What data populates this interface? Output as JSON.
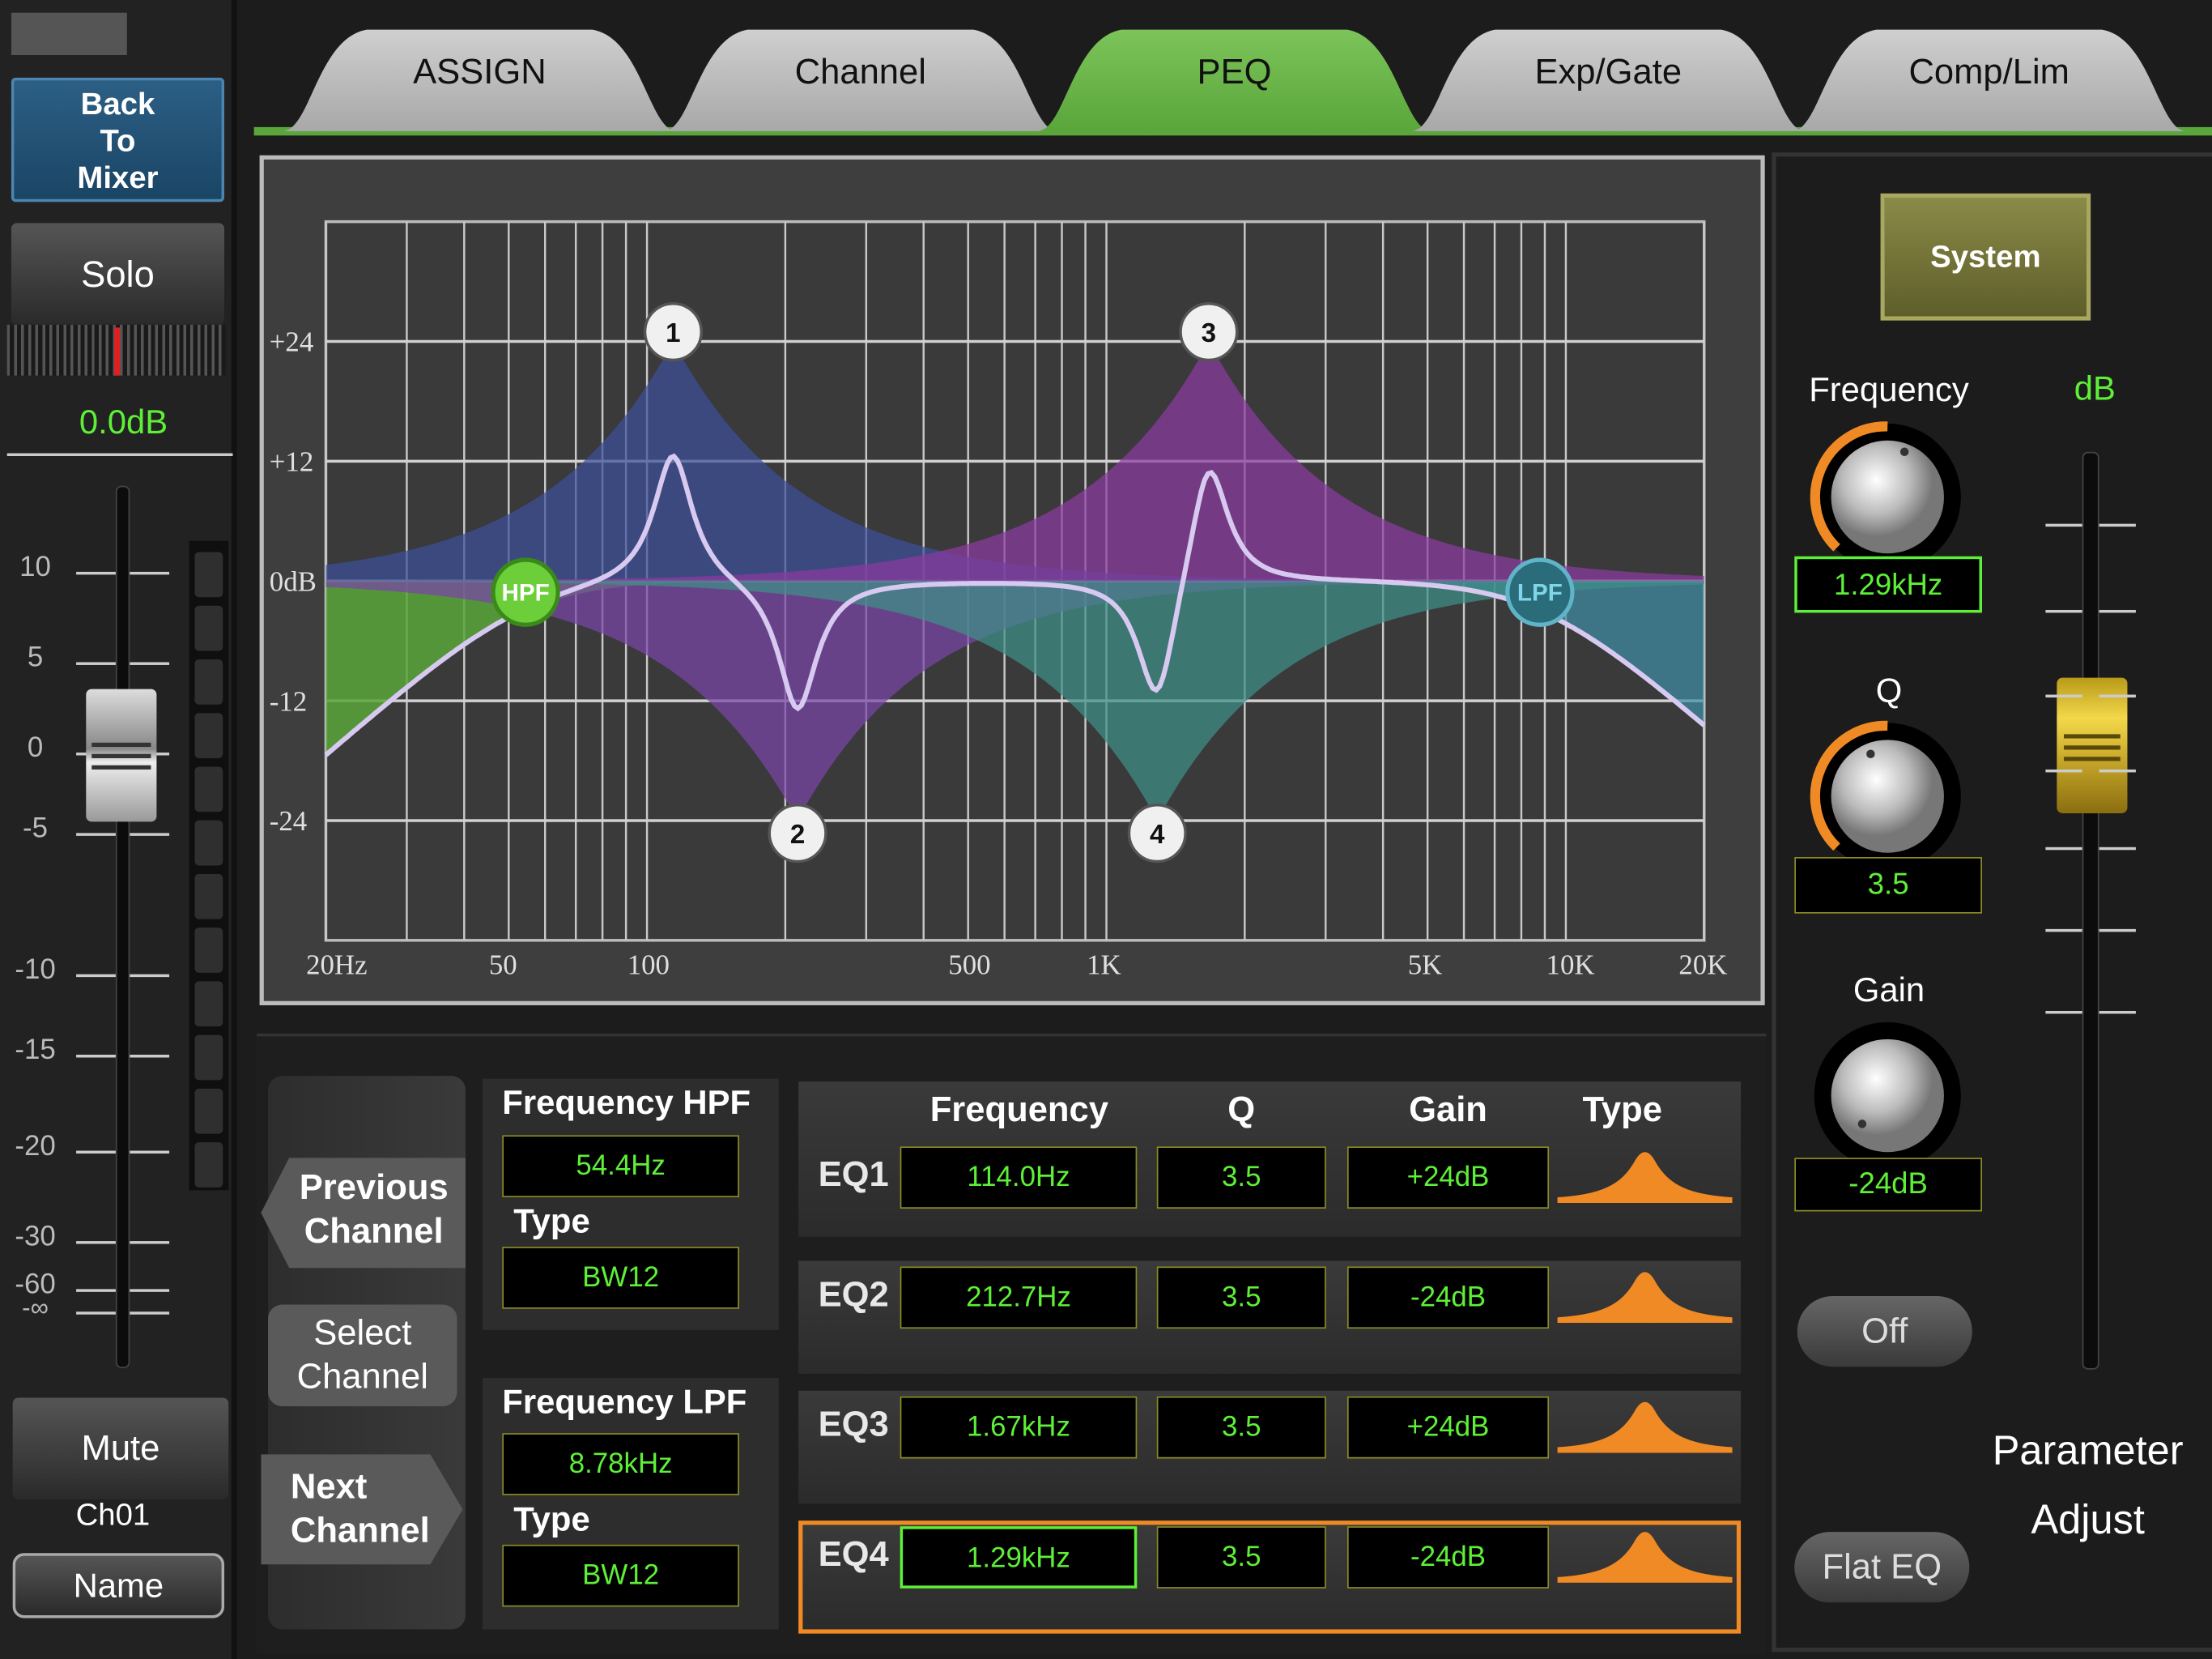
{
  "left_strip": {
    "back_label": "Back To Mixer",
    "solo_label": "Solo",
    "level_readout": "0.0dB",
    "fader_scale": [
      "10",
      "5",
      "0",
      "-5",
      "-10",
      "-15",
      "-20",
      "-30",
      "-60",
      "-∞"
    ],
    "mute_label": "Mute",
    "channel_name": "Ch01",
    "name_button": "Name"
  },
  "tabs": [
    {
      "label": "ASSIGN",
      "active": false
    },
    {
      "label": "Channel",
      "active": false
    },
    {
      "label": "PEQ",
      "active": true
    },
    {
      "label": "Exp/Gate",
      "active": false
    },
    {
      "label": "Comp/Lim",
      "active": false
    }
  ],
  "graph": {
    "y_labels": [
      "+24",
      "+12",
      "0dB",
      "-12",
      "-24"
    ],
    "x_labels": [
      "20Hz",
      "50",
      "100",
      "500",
      "1K",
      "5K",
      "10K",
      "20K"
    ],
    "nodes": [
      "1",
      "2",
      "3",
      "4"
    ],
    "hpf_label": "HPF",
    "lpf_label": "LPF"
  },
  "chart_data": {
    "type": "line",
    "xscale": "log",
    "xlabel": "",
    "ylabel": "",
    "xlim": [
      20,
      20000
    ],
    "ylim": [
      -36,
      36
    ],
    "x_ticks": [
      "20Hz",
      "50",
      "100",
      "500",
      "1K",
      "5K",
      "10K",
      "20K"
    ],
    "y_ticks": [
      "+24",
      "+12",
      "0dB",
      "-12",
      "-24"
    ],
    "eq_bands": [
      {
        "label": "1",
        "freq_hz": 114.0,
        "gain_db": 24,
        "q": 3.5,
        "color": "#3d4f9a"
      },
      {
        "label": "2",
        "freq_hz": 212.7,
        "gain_db": -24,
        "q": 3.5,
        "color": "#7a45a8"
      },
      {
        "label": "3",
        "freq_hz": 1670,
        "gain_db": 24,
        "q": 3.5,
        "color": "#8a3aa0"
      },
      {
        "label": "4",
        "freq_hz": 1290,
        "gain_db": -24,
        "q": 3.5,
        "color": "#3f8f88"
      }
    ],
    "filters": [
      {
        "label": "HPF",
        "freq_hz": 54.4,
        "type": "BW12",
        "color": "#6ccf3a"
      },
      {
        "label": "LPF",
        "freq_hz": 8780,
        "type": "BW12",
        "color": "#5fb4c8"
      }
    ]
  },
  "filters_panel": {
    "prev_label": "Previous Channel",
    "select_label": "Select Channel",
    "next_label": "Next Channel",
    "hpf_title": "Frequency HPF",
    "hpf_value": "54.4Hz",
    "hpf_type_label": "Type",
    "hpf_type": "BW12",
    "lpf_title": "Frequency LPF",
    "lpf_value": "8.78kHz",
    "lpf_type_label": "Type",
    "lpf_type": "BW12"
  },
  "eq_table": {
    "headers": {
      "frequency": "Frequency",
      "q": "Q",
      "gain": "Gain",
      "type": "Type"
    },
    "rows": [
      {
        "name": "EQ1",
        "frequency": "114.0Hz",
        "q": "3.5",
        "gain": "+24dB"
      },
      {
        "name": "EQ2",
        "frequency": "212.7Hz",
        "q": "3.5",
        "gain": "-24dB"
      },
      {
        "name": "EQ3",
        "frequency": "1.67kHz",
        "q": "3.5",
        "gain": "+24dB"
      },
      {
        "name": "EQ4",
        "frequency": "1.29kHz",
        "q": "3.5",
        "gain": "-24dB",
        "selected": true
      }
    ]
  },
  "right_panel": {
    "system_label": "System",
    "frequency_label": "Frequency",
    "frequency_value": "1.29kHz",
    "q_label": "Q",
    "q_value": "3.5",
    "gain_label": "Gain",
    "gain_value": "-24dB",
    "db_label": "dB",
    "off_label": "Off",
    "flat_eq_label": "Flat EQ",
    "parameter_adjust_label": "Parameter Adjust"
  },
  "colors": {
    "accent_green": "#5ef037",
    "active_tab": "#5aa63a",
    "selected_row": "#f08a24",
    "knob_ring": "#f08a24",
    "system_button": "#7a7a3a"
  }
}
